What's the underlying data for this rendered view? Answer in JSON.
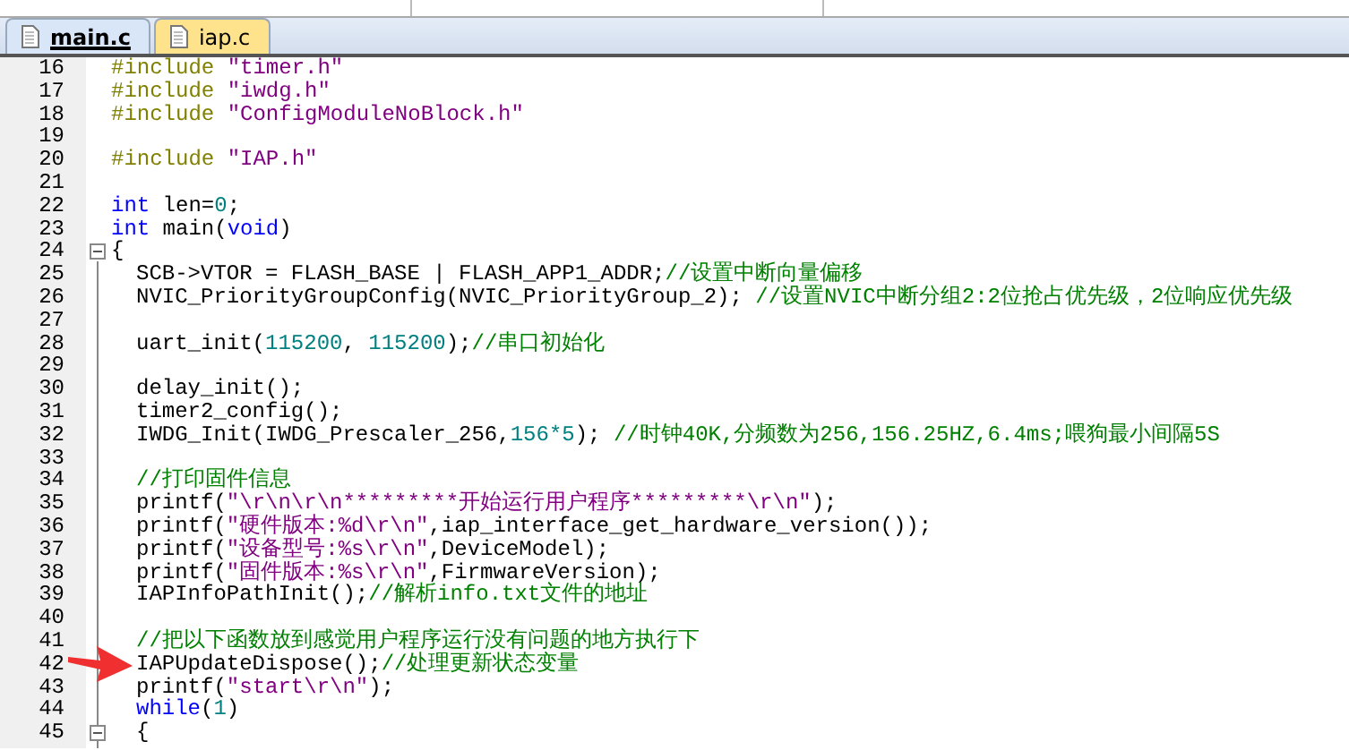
{
  "tabs": [
    {
      "label": "main.c",
      "selected": true
    },
    {
      "label": "iap.c",
      "selected": false
    }
  ],
  "lines": [
    {
      "number": "16",
      "indented": false,
      "tokens": [
        {
          "kind": "preproc",
          "text": "#include "
        },
        {
          "kind": "string",
          "text": "\"timer.h\""
        }
      ]
    },
    {
      "number": "17",
      "indented": false,
      "tokens": [
        {
          "kind": "preproc",
          "text": "#include "
        },
        {
          "kind": "string",
          "text": "\"iwdg.h\""
        }
      ]
    },
    {
      "number": "18",
      "indented": false,
      "tokens": [
        {
          "kind": "preproc",
          "text": "#include "
        },
        {
          "kind": "string",
          "text": "\"ConfigModuleNoBlock.h\""
        }
      ]
    },
    {
      "number": "19"
    },
    {
      "number": "20",
      "indented": false,
      "tokens": [
        {
          "kind": "preproc",
          "text": "#include "
        },
        {
          "kind": "string",
          "text": "\"IAP.h\""
        }
      ]
    },
    {
      "number": "21"
    },
    {
      "number": "22",
      "indented": false,
      "tokens": [
        {
          "kind": "keyword",
          "text": "int"
        },
        {
          "kind": "plain",
          "text": " len="
        },
        {
          "kind": "number",
          "text": "0"
        },
        {
          "kind": "plain",
          "text": ";"
        }
      ]
    },
    {
      "number": "23",
      "indented": false,
      "tokens": [
        {
          "kind": "keyword",
          "text": "int"
        },
        {
          "kind": "plain",
          "text": " main("
        },
        {
          "kind": "keyword",
          "text": "void"
        },
        {
          "kind": "plain",
          "text": ")"
        }
      ]
    },
    {
      "number": "24",
      "indented": false,
      "fold": true,
      "tokens": [
        {
          "kind": "plain",
          "text": "{"
        }
      ]
    },
    {
      "number": "25",
      "indented": true,
      "tokens": [
        {
          "kind": "plain",
          "text": "SCB->VTOR = FLASH_BASE | FLASH_APP1_ADDR;"
        },
        {
          "kind": "comment",
          "text": "//设置中断向量偏移"
        }
      ]
    },
    {
      "number": "26",
      "indented": true,
      "tokens": [
        {
          "kind": "plain",
          "text": "NVIC_PriorityGroupConfig(NVIC_PriorityGroup_2); "
        },
        {
          "kind": "comment",
          "text": "//设置NVIC中断分组2:2位抢占优先级，2位响应优先级"
        }
      ]
    },
    {
      "number": "27"
    },
    {
      "number": "28",
      "indented": true,
      "tokens": [
        {
          "kind": "plain",
          "text": "uart_init("
        },
        {
          "kind": "number",
          "text": "115200"
        },
        {
          "kind": "plain",
          "text": ", "
        },
        {
          "kind": "number",
          "text": "115200"
        },
        {
          "kind": "plain",
          "text": ");"
        },
        {
          "kind": "comment",
          "text": "//串口初始化"
        }
      ]
    },
    {
      "number": "29"
    },
    {
      "number": "30",
      "indented": true,
      "tokens": [
        {
          "kind": "plain",
          "text": "delay_init();"
        }
      ]
    },
    {
      "number": "31",
      "indented": true,
      "tokens": [
        {
          "kind": "plain",
          "text": "timer2_config();"
        }
      ]
    },
    {
      "number": "32",
      "indented": true,
      "tokens": [
        {
          "kind": "plain",
          "text": "IWDG_Init(IWDG_Prescaler_256,"
        },
        {
          "kind": "number",
          "text": "156*5"
        },
        {
          "kind": "plain",
          "text": "); "
        },
        {
          "kind": "comment",
          "text": "//时钟40K,分频数为256,156.25HZ,6.4ms;喂狗最小间隔5S"
        }
      ]
    },
    {
      "number": "33"
    },
    {
      "number": "34",
      "indented": true,
      "tokens": [
        {
          "kind": "comment",
          "text": "//打印固件信息"
        }
      ]
    },
    {
      "number": "35",
      "indented": true,
      "tokens": [
        {
          "kind": "plain",
          "text": "printf("
        },
        {
          "kind": "string",
          "text": "\"\\r\\n\\r\\n*********开始运行用户程序*********\\r\\n\""
        },
        {
          "kind": "plain",
          "text": ");"
        }
      ]
    },
    {
      "number": "36",
      "indented": true,
      "tokens": [
        {
          "kind": "plain",
          "text": "printf("
        },
        {
          "kind": "string",
          "text": "\"硬件版本:%d\\r\\n\""
        },
        {
          "kind": "plain",
          "text": ",iap_interface_get_hardware_version());"
        }
      ]
    },
    {
      "number": "37",
      "indented": true,
      "tokens": [
        {
          "kind": "plain",
          "text": "printf("
        },
        {
          "kind": "string",
          "text": "\"设备型号:%s\\r\\n\""
        },
        {
          "kind": "plain",
          "text": ",DeviceModel);"
        }
      ]
    },
    {
      "number": "38",
      "indented": true,
      "tokens": [
        {
          "kind": "plain",
          "text": "printf("
        },
        {
          "kind": "string",
          "text": "\"固件版本:%s\\r\\n\""
        },
        {
          "kind": "plain",
          "text": ",FirmwareVersion);"
        }
      ]
    },
    {
      "number": "39",
      "indented": true,
      "tokens": [
        {
          "kind": "plain",
          "text": "IAPInfoPathInit();"
        },
        {
          "kind": "comment",
          "text": "//解析info.txt文件的地址"
        }
      ]
    },
    {
      "number": "40"
    },
    {
      "number": "41",
      "indented": true,
      "tokens": [
        {
          "kind": "comment",
          "text": "//把以下函数放到感觉用户程序运行没有问题的地方执行下"
        }
      ]
    },
    {
      "number": "42",
      "indented": true,
      "tokens": [
        {
          "kind": "plain",
          "text": "IAPUpdateDispose();"
        },
        {
          "kind": "comment",
          "text": "//处理更新状态变量"
        }
      ]
    },
    {
      "number": "43",
      "indented": true,
      "tokens": [
        {
          "kind": "plain",
          "text": "printf("
        },
        {
          "kind": "string",
          "text": "\"start\\r\\n\""
        },
        {
          "kind": "plain",
          "text": ");"
        }
      ]
    },
    {
      "number": "44",
      "indented": true,
      "tokens": [
        {
          "kind": "keyword",
          "text": "while"
        },
        {
          "kind": "plain",
          "text": "("
        },
        {
          "kind": "number",
          "text": "1"
        },
        {
          "kind": "plain",
          "text": ")"
        }
      ]
    },
    {
      "number": "45",
      "indented": true,
      "fold": true,
      "tokens": [
        {
          "kind": "plain",
          "text": "{"
        }
      ]
    }
  ]
}
